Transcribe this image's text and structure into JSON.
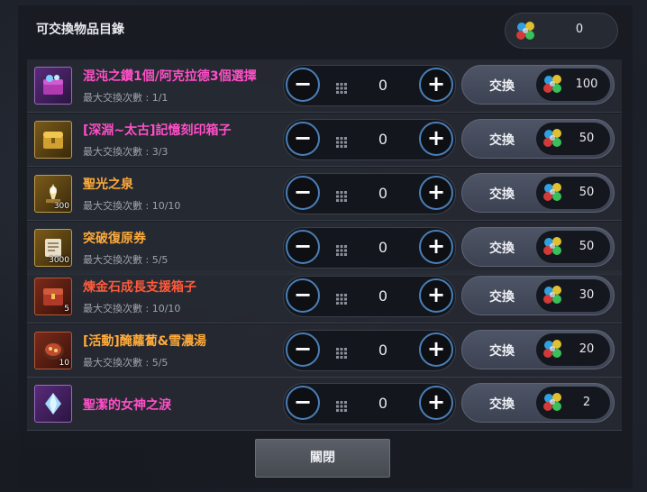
{
  "header": {
    "title": "可交換物品目錄"
  },
  "currency": {
    "icon": "gem-cluster-icon",
    "amount": "0"
  },
  "items": [
    {
      "name": "混沌之鑽1個/阿克拉德3個選擇",
      "limit": "最大交換次數 : 1/1",
      "count": "",
      "qty": "0",
      "exchange_label": "交換",
      "price": "100",
      "color": "#ff4fc8",
      "thumb_icon": "treasure-chest-icon"
    },
    {
      "name": "[深淵~太古]記憶刻印箱子",
      "limit": "最大交換次數 : 3/3",
      "count": "",
      "qty": "0",
      "exchange_label": "交換",
      "price": "50",
      "color": "#ff4fc8",
      "thumb_icon": "gold-chest-icon"
    },
    {
      "name": "聖光之泉",
      "limit": "最大交換次數 : 10/10",
      "count": "300",
      "qty": "0",
      "exchange_label": "交換",
      "price": "50",
      "color": "#ffab3a",
      "thumb_icon": "holy-fountain-icon"
    },
    {
      "name": "突破復原券",
      "limit": "最大交換次數 : 5/5",
      "count": "3000",
      "qty": "0",
      "exchange_label": "交換",
      "price": "50",
      "color": "#ffab3a",
      "thumb_icon": "scroll-ticket-icon"
    },
    {
      "name": "煉金石成長支援箱子",
      "limit": "最大交換次數 : 10/10",
      "count": "5",
      "qty": "0",
      "exchange_label": "交換",
      "price": "30",
      "color": "#ff5a3a",
      "thumb_icon": "red-chest-icon"
    },
    {
      "name": "[活動]醃蘿蔔&雪濃湯",
      "limit": "最大交換次數 : 5/5",
      "count": "10",
      "qty": "0",
      "exchange_label": "交換",
      "price": "20",
      "color": "#ffab3a",
      "thumb_icon": "soup-bowl-icon"
    },
    {
      "name": "聖潔的女神之淚",
      "limit": "",
      "count": "",
      "qty": "0",
      "exchange_label": "交換",
      "price": "2",
      "color": "#ff4fc8",
      "thumb_icon": "crystal-tear-icon"
    }
  ],
  "footer": {
    "close_label": "關閉"
  }
}
